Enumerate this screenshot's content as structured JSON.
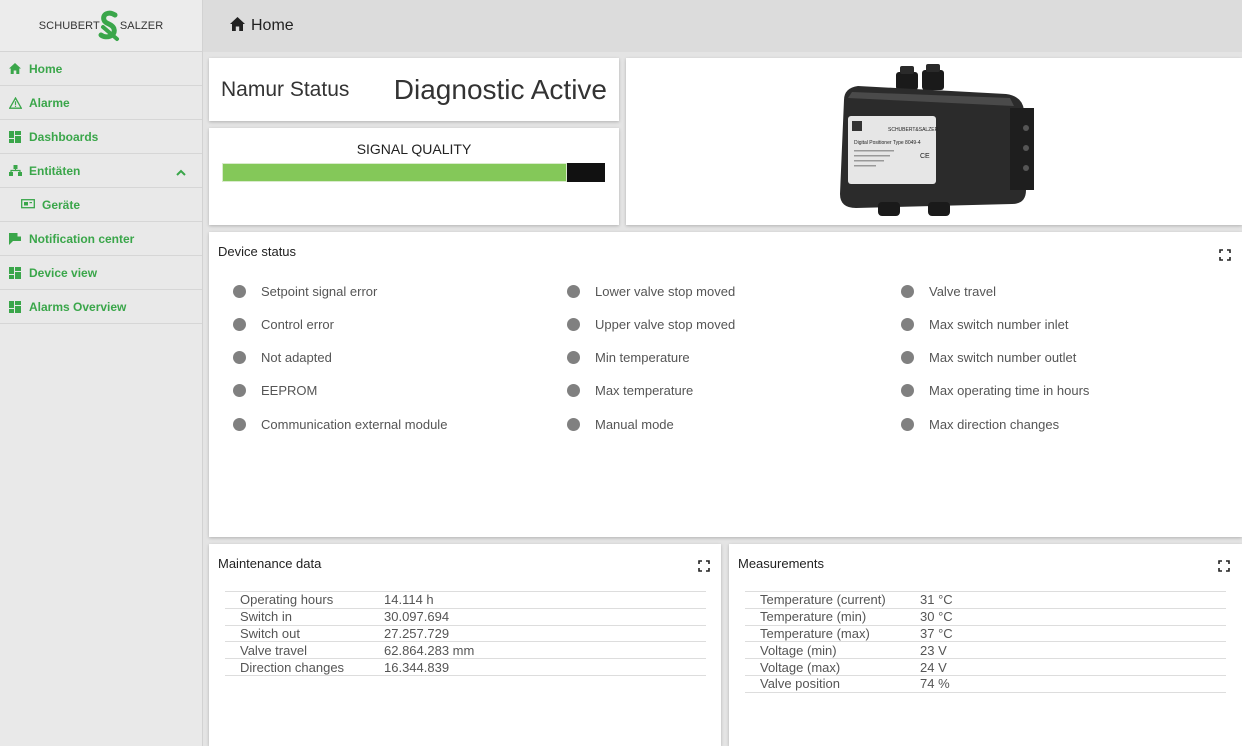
{
  "brand": {
    "left": "SCHUBERT",
    "right": "SALZER",
    "accent": "#3aa64a"
  },
  "sidebar": {
    "items": [
      {
        "label": "Home",
        "icon": "home-icon"
      },
      {
        "label": "Alarme",
        "icon": "warning-icon"
      },
      {
        "label": "Dashboards",
        "icon": "dashboard-icon"
      },
      {
        "label": "Entitäten",
        "icon": "entities-icon",
        "expanded": true
      },
      {
        "label": "Geräte",
        "icon": "devices-icon"
      },
      {
        "label": "Notification center",
        "icon": "notification-icon"
      },
      {
        "label": "Device view",
        "icon": "dashboard-icon"
      },
      {
        "label": "Alarms Overview",
        "icon": "dashboard-icon"
      }
    ]
  },
  "topbar": {
    "title": "Home",
    "icon": "home-icon"
  },
  "namur": {
    "label": "Namur Status",
    "value": "Diagnostic Active"
  },
  "signal_quality": {
    "title": "SIGNAL QUALITY",
    "level": 0.9,
    "fill_color": "#84c859"
  },
  "product_label": {
    "brand": "SCHUBERT&SALZER",
    "title": "Digital Positioner Type 8049-4",
    "mark": "CE"
  },
  "device_status": {
    "title": "Device status",
    "indicator_color": "#808080",
    "columns": [
      [
        "Setpoint signal error",
        "Control error",
        "Not adapted",
        "EEPROM",
        "Communication external module"
      ],
      [
        "Lower valve stop moved",
        "Upper valve stop moved",
        "Min temperature",
        "Max temperature",
        "Manual mode"
      ],
      [
        "Valve travel",
        "Max switch number inlet",
        "Max switch number outlet",
        "Max operating time in hours",
        "Max direction changes"
      ]
    ]
  },
  "maintenance": {
    "title": "Maintenance data",
    "rows": [
      [
        "Operating hours",
        "14.114 h"
      ],
      [
        "Switch in",
        "30.097.694"
      ],
      [
        "Switch out",
        "27.257.729"
      ],
      [
        "Valve travel",
        "62.864.283 mm"
      ],
      [
        "Direction changes",
        "16.344.839"
      ]
    ]
  },
  "measurements": {
    "title": "Measurements",
    "rows": [
      [
        "Temperature (current)",
        "31 °C"
      ],
      [
        "Temperature (min)",
        "30 °C"
      ],
      [
        "Temperature (max)",
        "37 °C"
      ],
      [
        "Voltage (min)",
        "23 V"
      ],
      [
        "Voltage (max)",
        "24 V"
      ],
      [
        "Valve position",
        "74 %"
      ]
    ]
  }
}
